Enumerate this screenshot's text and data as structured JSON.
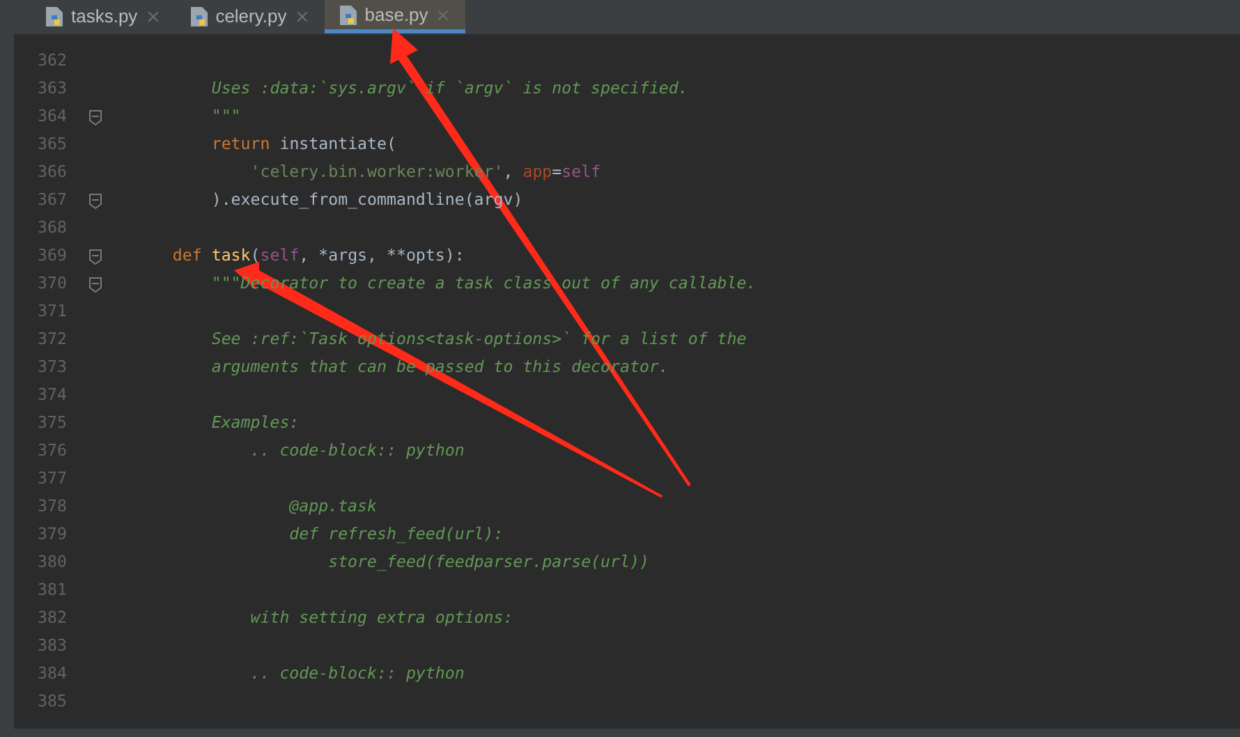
{
  "tabs": [
    {
      "label": "tasks.py",
      "selected": false
    },
    {
      "label": "celery.py",
      "selected": false
    },
    {
      "label": "base.py",
      "selected": true
    }
  ],
  "lines": [
    {
      "number": "362",
      "fold": false
    },
    {
      "number": "363",
      "fold": false,
      "tokens": [
        {
          "kind": "doc",
          "text": "        Uses :data:`sys.argv` if `argv` is not specified."
        }
      ]
    },
    {
      "number": "364",
      "fold": true,
      "tokens": [
        {
          "kind": "doc",
          "text": "        \"\"\""
        }
      ]
    },
    {
      "number": "365",
      "fold": false,
      "tokens": [
        {
          "kind": "keyword",
          "text": "        return"
        },
        {
          "kind": "plain",
          "text": " instantiate("
        }
      ]
    },
    {
      "number": "366",
      "fold": false,
      "tokens": [
        {
          "kind": "string",
          "text": "            'celery.bin.worker:worker'"
        },
        {
          "kind": "plain",
          "text": ", "
        },
        {
          "kind": "param",
          "text": "app"
        },
        {
          "kind": "plain",
          "text": "="
        },
        {
          "kind": "self",
          "text": "self"
        }
      ]
    },
    {
      "number": "367",
      "fold": true,
      "tokens": [
        {
          "kind": "plain",
          "text": "        ).execute_from_commandline(argv)"
        }
      ]
    },
    {
      "number": "368",
      "fold": false
    },
    {
      "number": "369",
      "fold": true,
      "tokens": [
        {
          "kind": "keyword",
          "text": "    def "
        },
        {
          "kind": "fn",
          "text": "task"
        },
        {
          "kind": "plain",
          "text": "("
        },
        {
          "kind": "self",
          "text": "self"
        },
        {
          "kind": "plain",
          "text": ", *args, **opts):"
        }
      ]
    },
    {
      "number": "370",
      "fold": true,
      "tokens": [
        {
          "kind": "doc",
          "text": "        \"\"\"Decorator to create a task class out of any callable."
        }
      ]
    },
    {
      "number": "371",
      "fold": false
    },
    {
      "number": "372",
      "fold": false,
      "tokens": [
        {
          "kind": "doc",
          "text": "        See :ref:`Task options<task-options>` for a list of the"
        }
      ]
    },
    {
      "number": "373",
      "fold": false,
      "tokens": [
        {
          "kind": "doc",
          "text": "        arguments that can be passed to this decorator."
        }
      ]
    },
    {
      "number": "374",
      "fold": false
    },
    {
      "number": "375",
      "fold": false,
      "tokens": [
        {
          "kind": "doc",
          "text": "        Examples:"
        }
      ]
    },
    {
      "number": "376",
      "fold": false,
      "tokens": [
        {
          "kind": "doc",
          "text": "            .. code-block:: python"
        }
      ]
    },
    {
      "number": "377",
      "fold": false
    },
    {
      "number": "378",
      "fold": false,
      "tokens": [
        {
          "kind": "doc",
          "text": "                @app.task"
        }
      ]
    },
    {
      "number": "379",
      "fold": false,
      "tokens": [
        {
          "kind": "doc",
          "text": "                def refresh_feed(url):"
        }
      ]
    },
    {
      "number": "380",
      "fold": false,
      "tokens": [
        {
          "kind": "doc",
          "text": "                    store_feed(feedparser.parse(url))"
        }
      ]
    },
    {
      "number": "381",
      "fold": false
    },
    {
      "number": "382",
      "fold": false,
      "tokens": [
        {
          "kind": "doc",
          "text": "            with setting extra options:"
        }
      ]
    },
    {
      "number": "383",
      "fold": false
    },
    {
      "number": "384",
      "fold": false,
      "tokens": [
        {
          "kind": "doc",
          "text": "            .. code-block:: python"
        }
      ]
    },
    {
      "number": "385",
      "fold": false
    }
  ]
}
